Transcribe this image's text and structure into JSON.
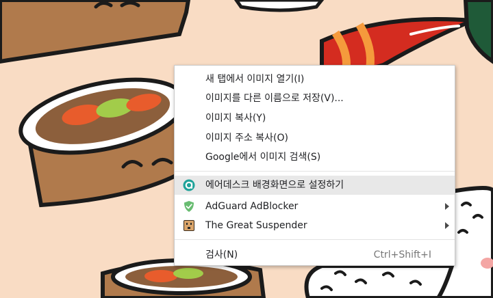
{
  "wallpaper": {
    "background_color": "#f9dcc4",
    "illustration": "sushi-rolls-and-shrimp-pattern"
  },
  "context_menu": {
    "items": [
      {
        "label": "새 탭에서 이미지 열기(I)"
      },
      {
        "label": "이미지를 다른 이름으로 저장(V)..."
      },
      {
        "label": "이미지 복사(Y)"
      },
      {
        "label": "이미지 주소 복사(O)"
      },
      {
        "label": "Google에서 이미지 검색(S)"
      },
      {
        "label": "에어데스크 배경화면으로 설정하기",
        "icon": "airdesk-icon",
        "highlighted": true
      },
      {
        "label": "AdGuard AdBlocker",
        "icon": "adguard-shield-icon",
        "has_submenu": true
      },
      {
        "label": "The Great Suspender",
        "icon": "great-suspender-icon",
        "has_submenu": true
      },
      {
        "label": "검사(N)",
        "shortcut": "Ctrl+Shift+I"
      }
    ],
    "colors": {
      "highlight": "#e8e8e8",
      "adguard_green": "#68bc71",
      "airdesk_teal": "#1fa39a"
    }
  }
}
